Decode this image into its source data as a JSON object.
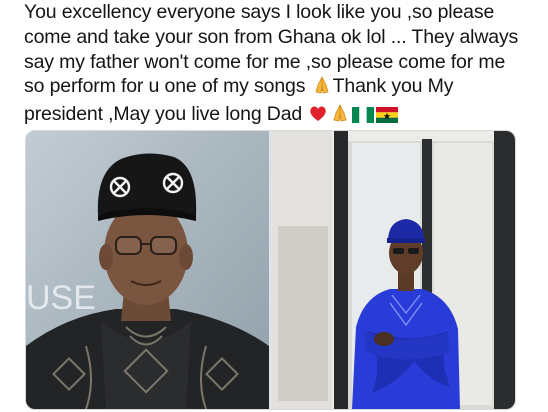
{
  "tweet": {
    "lines": [
      "You excellency everyone says I look like you ,so please",
      "come and take your son from Ghana ok lol ... They always",
      "say my father won't come for me ,so please come for me",
      "so perform for u one of my songs",
      "Thank you My",
      "president ,May you live long  Dad"
    ]
  },
  "icons": {
    "heart": "red-heart-icon",
    "pray": "folded-hands-icon",
    "flag_ng": "nigeria-flag-icon",
    "flag_gh": "ghana-flag-icon"
  },
  "colors": {
    "text": "#151515",
    "heart": "#e0202b",
    "pray": "#f6b73c",
    "nigeria_green": "#008751",
    "ghana_red": "#ce1126",
    "ghana_gold": "#fcd116",
    "ghana_green": "#006b3f",
    "agbada_blue": "#2a3cd8"
  },
  "media": {
    "left_photo_text": "USE"
  }
}
